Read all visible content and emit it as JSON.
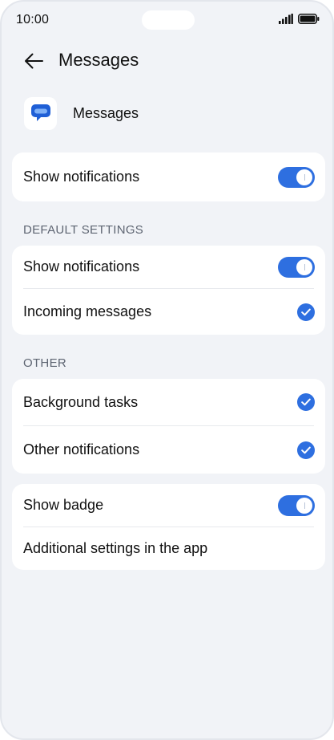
{
  "status_bar": {
    "time": "10:00"
  },
  "header": {
    "title": "Messages"
  },
  "app": {
    "name": "Messages"
  },
  "main_card": {
    "show_notifications": {
      "label": "Show notifications",
      "enabled": true
    }
  },
  "default_settings": {
    "section_label": "DEFAULT SETTINGS",
    "show_notifications": {
      "label": "Show notifications",
      "enabled": true
    },
    "incoming_messages": {
      "label": "Incoming messages",
      "checked": true
    }
  },
  "other": {
    "section_label": "OTHER",
    "background_tasks": {
      "label": "Background tasks",
      "checked": true
    },
    "other_notifications": {
      "label": "Other notifications",
      "checked": true
    }
  },
  "badge_card": {
    "show_badge": {
      "label": "Show badge",
      "enabled": true
    },
    "additional_settings": {
      "label": "Additional settings in the app"
    }
  },
  "colors": {
    "accent": "#2e6fe0",
    "background": "#f1f3f7",
    "card": "#ffffff"
  },
  "icons": {
    "back": "arrow-left-icon",
    "app": "messages-app-icon",
    "signal": "signal-icon",
    "battery": "battery-icon",
    "check": "checkmark-icon"
  }
}
